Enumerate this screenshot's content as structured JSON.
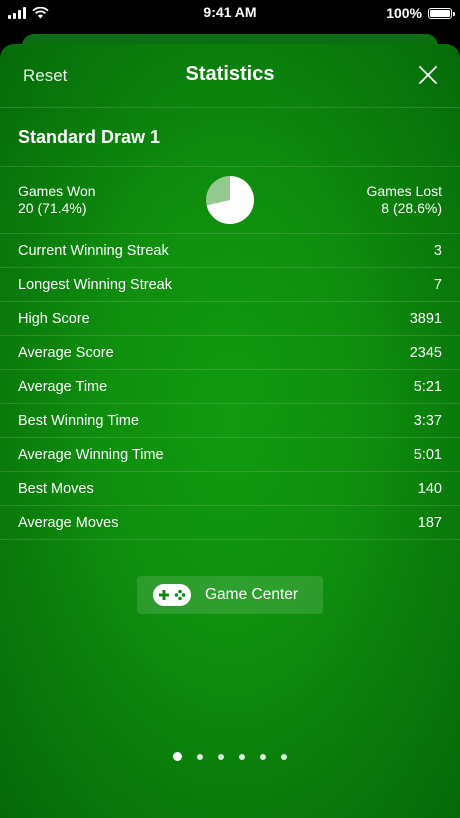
{
  "status_bar": {
    "time": "9:41 AM",
    "battery": "100%"
  },
  "nav": {
    "reset_label": "Reset",
    "title": "Statistics"
  },
  "section": {
    "title": "Standard Draw 1"
  },
  "summary": {
    "won_label": "Games Won",
    "won_value": "20 (71.4%)",
    "lost_label": "Games Lost",
    "lost_value": "8 (28.6%)",
    "won_fraction": 0.714
  },
  "stats": [
    {
      "label": "Current Winning Streak",
      "value": "3"
    },
    {
      "label": "Longest Winning Streak",
      "value": "7"
    },
    {
      "label": "High Score",
      "value": "3891"
    },
    {
      "label": "Average Score",
      "value": "2345"
    },
    {
      "label": "Average Time",
      "value": "5:21"
    },
    {
      "label": "Best Winning Time",
      "value": "3:37"
    },
    {
      "label": "Average Winning Time",
      "value": "5:01"
    },
    {
      "label": "Best Moves",
      "value": "140"
    },
    {
      "label": "Average Moves",
      "value": "187"
    }
  ],
  "game_center": {
    "label": "Game Center",
    "icon": "gamepad-icon"
  },
  "pagination": {
    "count": 6,
    "active": 0
  },
  "colors": {
    "pie_won": "#ffffff",
    "pie_lost": "#93c98f"
  }
}
